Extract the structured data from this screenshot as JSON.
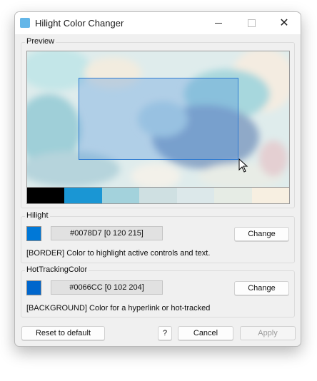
{
  "window": {
    "title": "Hilight Color Changer",
    "icon": "app-color-icon",
    "controls": {
      "minimize": "minimize-icon",
      "maximize": "maximize-icon",
      "close": "close-icon"
    }
  },
  "preview": {
    "label": "Preview",
    "strip_colors": [
      "#000000",
      "#1a96d4",
      "#a3d2dc",
      "#cfe0e2",
      "#dce8ea",
      "#e6ece5",
      "#f7efe1"
    ]
  },
  "hilight": {
    "label": "Hilight",
    "swatch_color": "#0078D7",
    "value": "#0078D7 [0 120 215]",
    "change_label": "Change",
    "description": "[BORDER] Color to highlight active controls and text."
  },
  "hot_tracking": {
    "label": "HotTrackingColor",
    "swatch_color": "#0066CC",
    "value": "#0066CC [0 102 204]",
    "change_label": "Change",
    "description": "[BACKGROUND] Color for a hyperlink or hot-tracked"
  },
  "footer": {
    "reset_label": "Reset to default",
    "help_label": "?",
    "cancel_label": "Cancel",
    "apply_label": "Apply"
  }
}
